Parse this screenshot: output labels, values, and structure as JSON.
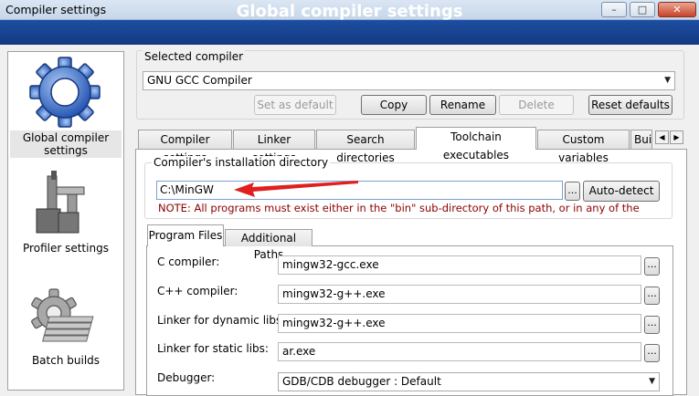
{
  "window": {
    "title": "Compiler settings",
    "buttons": {
      "minimize": "–",
      "maximize": "□",
      "close": "✕"
    }
  },
  "banner": {
    "title": "Global compiler settings"
  },
  "sidebar": {
    "items": [
      {
        "label": "Global compiler settings",
        "icon": "gear-icon",
        "selected": true
      },
      {
        "label": "Profiler settings",
        "icon": "caliper-icon",
        "selected": false
      },
      {
        "label": "Batch builds",
        "icon": "gear-stack-icon",
        "selected": false
      }
    ]
  },
  "compiler": {
    "group_label": "Selected compiler",
    "selected": "GNU GCC Compiler",
    "buttons": {
      "set_default": "Set as default",
      "copy": "Copy",
      "rename": "Rename",
      "delete": "Delete",
      "reset": "Reset defaults"
    }
  },
  "tabs": [
    {
      "label": "Compiler settings",
      "active": false
    },
    {
      "label": "Linker settings",
      "active": false
    },
    {
      "label": "Search directories",
      "active": false
    },
    {
      "label": "Toolchain executables",
      "active": true
    },
    {
      "label": "Custom variables",
      "active": false
    },
    {
      "label": "Bui",
      "active": false
    }
  ],
  "toolchain": {
    "install_label": "Compiler's installation directory",
    "install_dir": "C:\\MinGW",
    "browse": "...",
    "autodetect": "Auto-detect",
    "note": "NOTE: All programs must exist either in the \"bin\" sub-directory of this path, or in any of the",
    "subtabs": [
      {
        "label": "Program Files",
        "active": true
      },
      {
        "label": "Additional Paths",
        "active": false
      }
    ],
    "programs": [
      {
        "label": "C compiler:",
        "value": "mingw32-gcc.exe"
      },
      {
        "label": "C++ compiler:",
        "value": "mingw32-g++.exe"
      },
      {
        "label": "Linker for dynamic libs:",
        "value": "mingw32-g++.exe"
      },
      {
        "label": "Linker for static libs:",
        "value": "ar.exe"
      }
    ],
    "debugger": {
      "label": "Debugger:",
      "value": "GDB/CDB debugger : Default"
    }
  },
  "colors": {
    "banner": "#1a4593",
    "annotation_arrow": "#e02020",
    "note_text": "#8b0000"
  }
}
